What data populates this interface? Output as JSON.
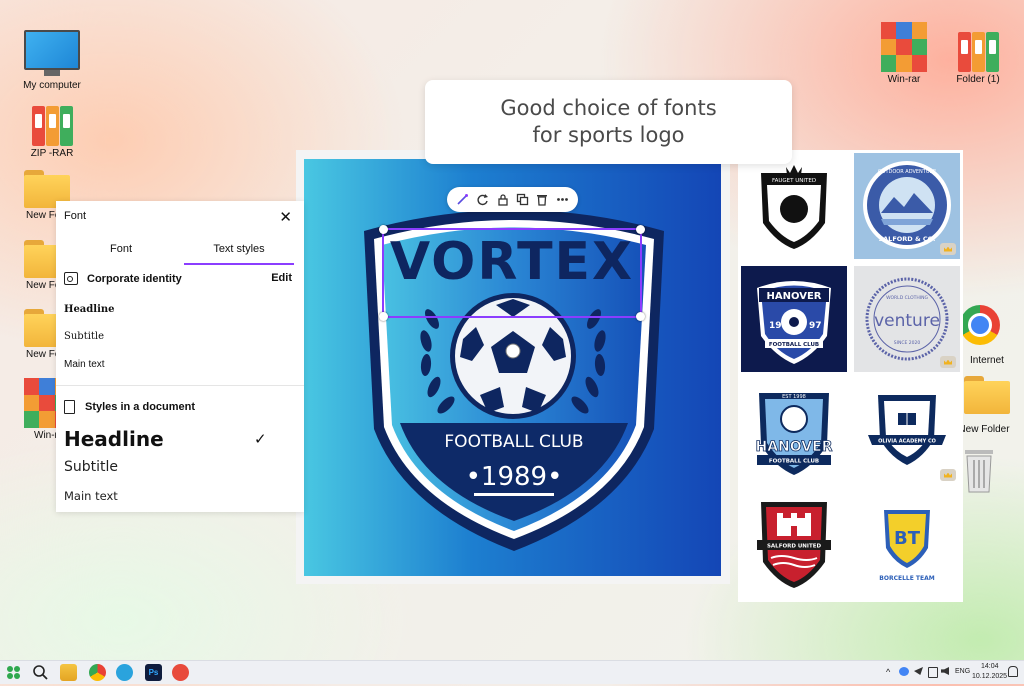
{
  "desktop": {
    "left_icons": [
      {
        "name": "my-computer",
        "label": "My computer"
      },
      {
        "name": "zip-rar",
        "label": "ZIP -RAR"
      },
      {
        "name": "new-folder-1",
        "label": "New Fo"
      },
      {
        "name": "new-folder-2",
        "label": "New Fo"
      },
      {
        "name": "new-folder-3",
        "label": "New Fo"
      },
      {
        "name": "win-rar-left",
        "label": "Win-r"
      }
    ],
    "right_icons": [
      {
        "name": "win-rar",
        "label": "Win-rar"
      },
      {
        "name": "folder-1",
        "label": "Folder (1)"
      },
      {
        "name": "internet",
        "label": "Internet"
      },
      {
        "name": "new-folder-right",
        "label": "New Folder"
      }
    ]
  },
  "callout": {
    "line1": "Good choice of fonts",
    "line2": "for sports logo"
  },
  "logo": {
    "title": "VORTEX",
    "subtitle": "FOOTBALL CLUB",
    "year": "•1989•"
  },
  "font_panel": {
    "title": "Font",
    "tabs": [
      "Font",
      "Text styles"
    ],
    "active_tab": "Text styles",
    "corporate_label": "Corporate identity",
    "edit_label": "Edit",
    "corporate_styles": [
      "Headline",
      "Subtitle",
      "Main text"
    ],
    "doc_label": "Styles in a document",
    "doc_styles": [
      "Headline",
      "Subtitle",
      "Main text"
    ],
    "accent": "#8b3dff"
  },
  "gallery": [
    {
      "id": "fauget",
      "texts": [
        "FAUGET UNITED"
      ],
      "premium": false
    },
    {
      "id": "salford-co",
      "texts": [
        "OUTDOOR ADVENTURE",
        "SALFORD & CO."
      ],
      "premium": true
    },
    {
      "id": "hanover-1",
      "texts": [
        "HANOVER",
        "19",
        "97",
        "FOOTBALL CLUB"
      ],
      "premium": false
    },
    {
      "id": "venture",
      "texts": [
        "WORLD CLOTHING",
        "venture",
        "SINCE 2020"
      ],
      "premium": true
    },
    {
      "id": "hanover-2",
      "texts": [
        "EST 1998",
        "HANOVER",
        "FOOTBALL CLUB"
      ],
      "premium": false
    },
    {
      "id": "olivia",
      "texts": [
        "OLIVIA ACADEMY CO"
      ],
      "premium": true
    },
    {
      "id": "salford-united",
      "texts": [
        "SALFORD UNITED"
      ],
      "premium": false
    },
    {
      "id": "borcelle",
      "texts": [
        "BT",
        "BORCELLE TEAM"
      ],
      "premium": false
    }
  ],
  "taskbar": {
    "lang": "ENG",
    "time": "14:04",
    "date": "10.12.2025"
  }
}
